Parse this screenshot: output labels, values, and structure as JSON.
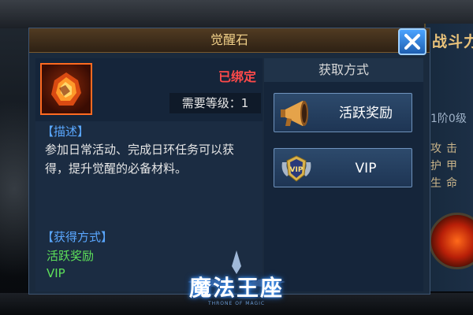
{
  "dialog": {
    "title": "觉醒石",
    "close_icon": "close-x-icon",
    "item": {
      "icon": "awakening-stone-icon",
      "bound_status": "已绑定",
      "level_label": "需要等级：",
      "level_value": "1"
    },
    "description": {
      "header": "【描述】",
      "text": "参加日常活动、完成日环任务可以获得，提升觉醒的必备材料。"
    },
    "sources": {
      "header": "【获得方式】",
      "items": [
        "活跃奖励",
        "VIP"
      ]
    },
    "acquire": {
      "header": "获取方式",
      "buttons": [
        {
          "label": "活跃奖励",
          "icon": "horn-icon"
        },
        {
          "label": "VIP",
          "icon": "vip-badge-icon"
        }
      ]
    }
  },
  "background_panel": {
    "title": "战斗力",
    "level_text": "1阶0级",
    "stats": [
      "攻击",
      "护甲",
      "生命"
    ]
  },
  "logo": {
    "title": "魔法王座",
    "subtitle": "THRONE OF MAGIC"
  },
  "colors": {
    "title_gold": "#f3d28a",
    "bound_red": "#ff4a4a",
    "header_blue": "#5aa7ff",
    "source_green": "#5ee05a",
    "panel_blue": "#1a2a3d"
  }
}
